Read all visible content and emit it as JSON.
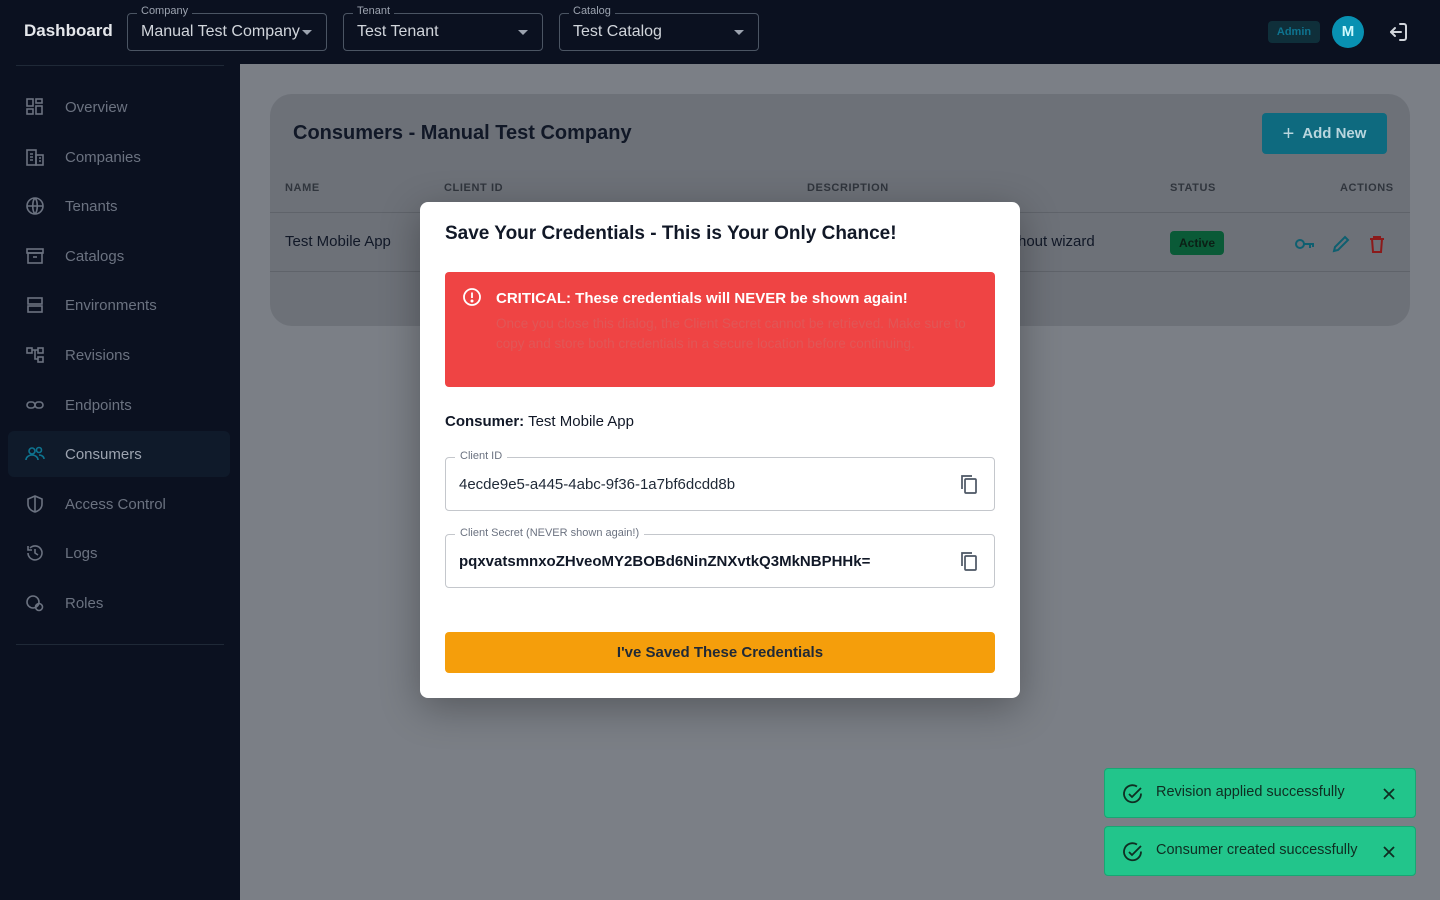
{
  "topbar": {
    "brand": "Dashboard",
    "company": {
      "label": "Company",
      "value": "Manual Test Company"
    },
    "tenant": {
      "label": "Tenant",
      "value": "Test Tenant"
    },
    "catalog": {
      "label": "Catalog",
      "value": "Test Catalog"
    },
    "admin_badge": "Admin",
    "avatar_initial": "M"
  },
  "sidebar": {
    "items": [
      {
        "label": "Overview",
        "icon": "grid-icon"
      },
      {
        "label": "Companies",
        "icon": "building-icon"
      },
      {
        "label": "Tenants",
        "icon": "globe-icon"
      },
      {
        "label": "Catalogs",
        "icon": "archive-icon"
      },
      {
        "label": "Environments",
        "icon": "server-icon"
      },
      {
        "label": "Revisions",
        "icon": "tree-icon"
      },
      {
        "label": "Endpoints",
        "icon": "link-icon"
      },
      {
        "label": "Consumers",
        "icon": "users-icon",
        "active": true
      },
      {
        "label": "Access Control",
        "icon": "shield-icon"
      },
      {
        "label": "Logs",
        "icon": "history-icon"
      },
      {
        "label": "Roles",
        "icon": "role-icon"
      }
    ]
  },
  "main": {
    "title": "Consumers - Manual Test Company",
    "add_button": "Add New",
    "columns": {
      "name": "NAME",
      "client_id": "CLIENT ID",
      "description": "DESCRIPTION",
      "status": "STATUS",
      "actions": "ACTIONS"
    },
    "row": {
      "name": "Test Mobile App",
      "description_partial": "hout wizard",
      "status": "Active"
    }
  },
  "modal": {
    "title": "Save Your Credentials - This is Your Only Chance!",
    "alert_title": "CRITICAL: These credentials will NEVER be shown again!",
    "alert_body": "Once you close this dialog, the Client Secret cannot be retrieved. Make sure to copy and store both credentials in a secure location before continuing.",
    "consumer_label": "Consumer:",
    "consumer_name": "Test Mobile App",
    "client_id_label": "Client ID",
    "client_id_value": "4ecde9e5-a445-4abc-9f36-1a7bf6dcdd8b",
    "client_secret_label": "Client Secret (NEVER shown again!)",
    "client_secret_value": "pqxvatsmnxoZHveoMY2BOBd6NinZNXvtkQ3MkNBPHHk=",
    "confirm_button": "I've Saved These Credentials"
  },
  "toasts": [
    {
      "text": "Revision applied successfully"
    },
    {
      "text": "Consumer created successfully"
    }
  ],
  "colors": {
    "sidebar_bg": "#0b1120",
    "accent": "#0891b2",
    "alert": "#ef4444",
    "confirm": "#f59e0b",
    "toast": "#22c58b"
  }
}
